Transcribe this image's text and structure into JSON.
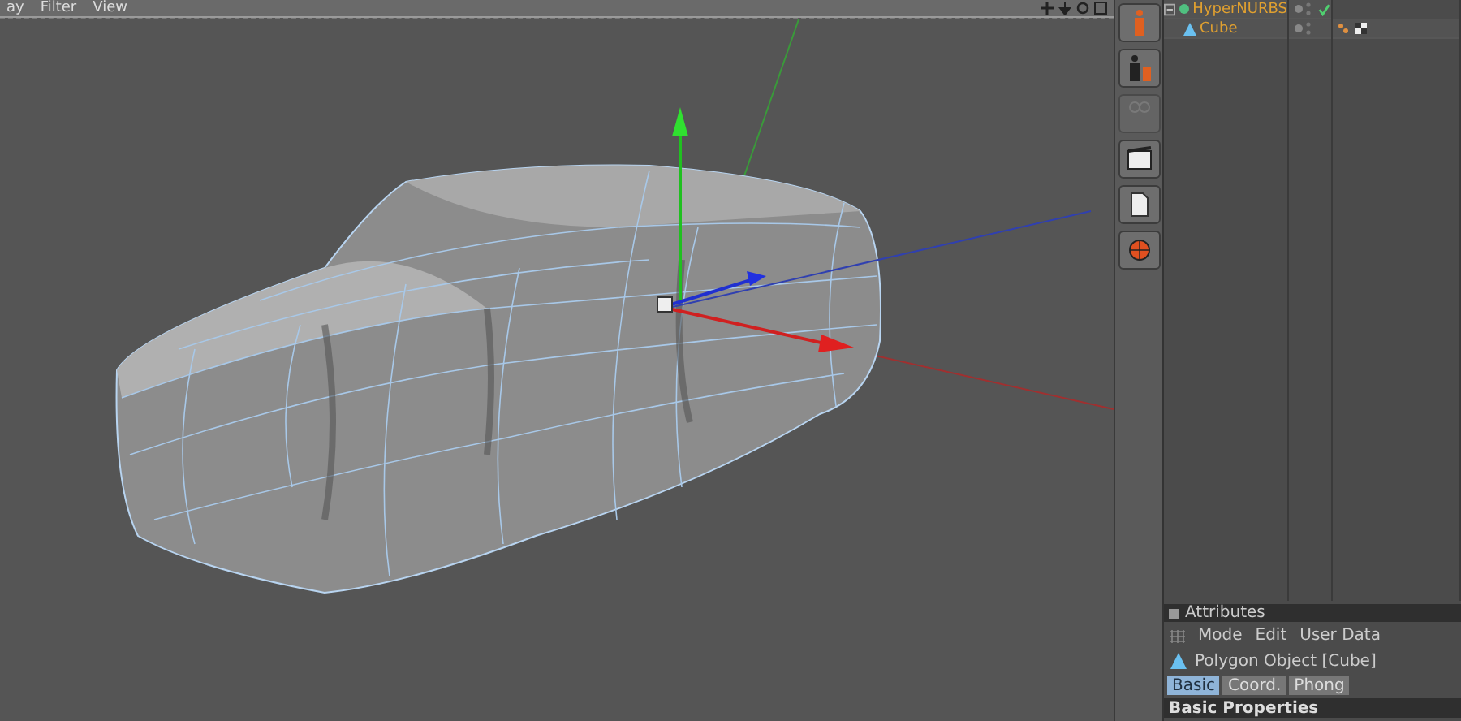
{
  "viewport": {
    "menu": [
      "ay",
      "Filter",
      "View"
    ]
  },
  "objects": [
    {
      "name": "HyperNURBS",
      "expanded": true,
      "checked": true,
      "children": [
        {
          "name": "Cube"
        }
      ]
    }
  ],
  "attributes": {
    "title": "Attributes",
    "menu": [
      "Mode",
      "Edit",
      "User Data"
    ],
    "object": "Polygon Object [Cube]",
    "tabs": [
      {
        "label": "Basic",
        "selected": true
      },
      {
        "label": "Coord.",
        "selected": false
      },
      {
        "label": "Phong",
        "selected": false
      }
    ],
    "section": "Basic Properties"
  }
}
